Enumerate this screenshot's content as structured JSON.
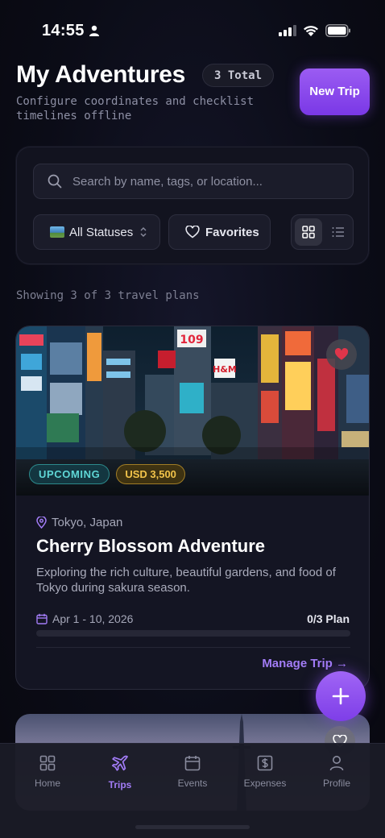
{
  "status_bar": {
    "time": "14:55"
  },
  "header": {
    "title": "My Adventures",
    "total_badge": "3 Total",
    "subtitle": "Configure coordinates and checklist timelines offline",
    "new_trip_label": "New Trip"
  },
  "filters": {
    "search_placeholder": "Search by name, tags, or location...",
    "status_select": "All Statuses",
    "favorites_label": "Favorites",
    "view_mode": "grid"
  },
  "results_text": "Showing 3 of 3 travel plans",
  "trips": [
    {
      "status": "UPCOMING",
      "budget": "USD 3,500",
      "location": "Tokyo, Japan",
      "title": "Cherry Blossom Adventure",
      "description": "Exploring the rich culture, beautiful gardens, and food of Tokyo during sakura season.",
      "dates": "Apr 1 - 10, 2026",
      "plan": "0/3 Plan",
      "plan_progress": 0,
      "favorite": true,
      "manage_label": "Manage Trip →"
    }
  ],
  "tabs": [
    {
      "label": "Home",
      "icon": "grid-icon",
      "active": false
    },
    {
      "label": "Trips",
      "icon": "plane-icon",
      "active": true
    },
    {
      "label": "Events",
      "icon": "calendar-icon",
      "active": false
    },
    {
      "label": "Expenses",
      "icon": "dollar-icon",
      "active": false
    },
    {
      "label": "Profile",
      "icon": "person-icon",
      "active": false
    }
  ],
  "colors": {
    "accent": "#8b5cf6",
    "upcoming": "#5fd6d6",
    "budget": "#f2c34a",
    "favorite": "#e0354a"
  }
}
